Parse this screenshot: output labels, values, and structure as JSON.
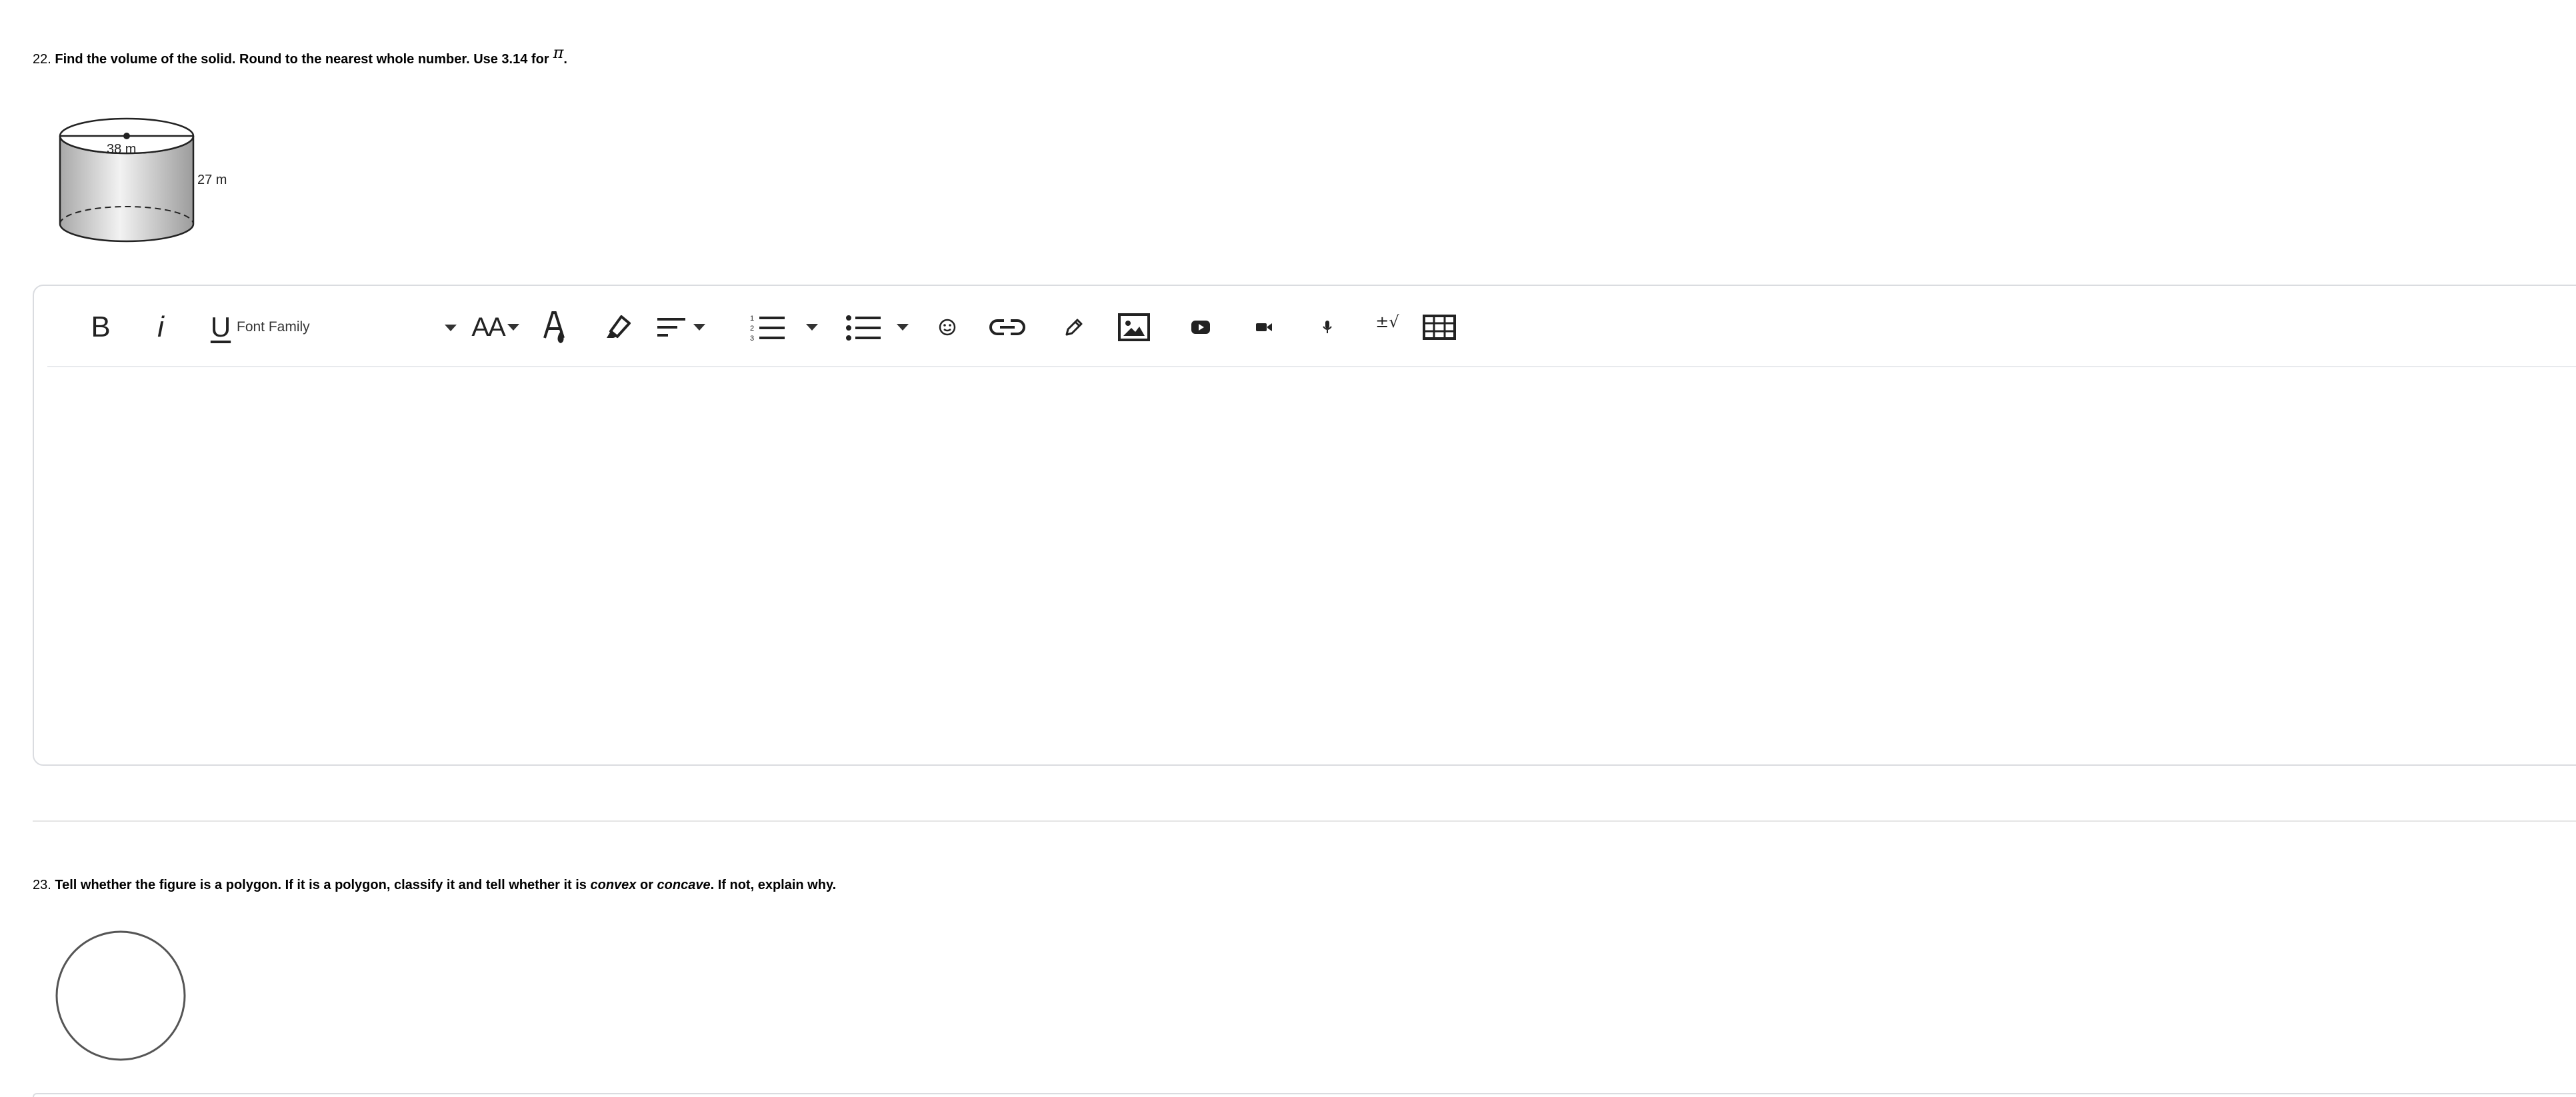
{
  "question_22": {
    "number": "22.",
    "text": "Find the volume of the solid. Round to the nearest whole number. Use 3.14 for",
    "pi_symbol": "π",
    "end_punct": ".",
    "figure": {
      "diameter_label": "38 m",
      "height_label": "27 m"
    }
  },
  "editor": {
    "toolbar": {
      "bold_label": "B",
      "italic_label": "i",
      "underline_label": "U",
      "font_family_label": "Font Family",
      "font_size_label": "AA",
      "math_label": "±√",
      "icons": [
        "bold-icon",
        "italic-icon",
        "underline-icon",
        "font-size-icon",
        "text-color-icon",
        "highlight-icon",
        "align-icon",
        "numbered-list-icon",
        "bulleted-list-icon",
        "emoji-icon",
        "link-icon",
        "draw-icon",
        "image-icon",
        "youtube-icon",
        "video-icon",
        "microphone-icon",
        "math-icon",
        "table-icon"
      ]
    },
    "body_value": ""
  },
  "question_23": {
    "number": "23.",
    "text_part1": "Tell whether the figure is a polygon. If it is a polygon, classify it and tell whether it is ",
    "convex": "convex",
    "text_part2": " or ",
    "concave": "concave",
    "text_part3": ". If not, explain why."
  },
  "colors": {
    "border": "#dadce0",
    "divider": "#e5e5e5",
    "icon": "#222222",
    "figure_fill": "#d9d9d9"
  }
}
